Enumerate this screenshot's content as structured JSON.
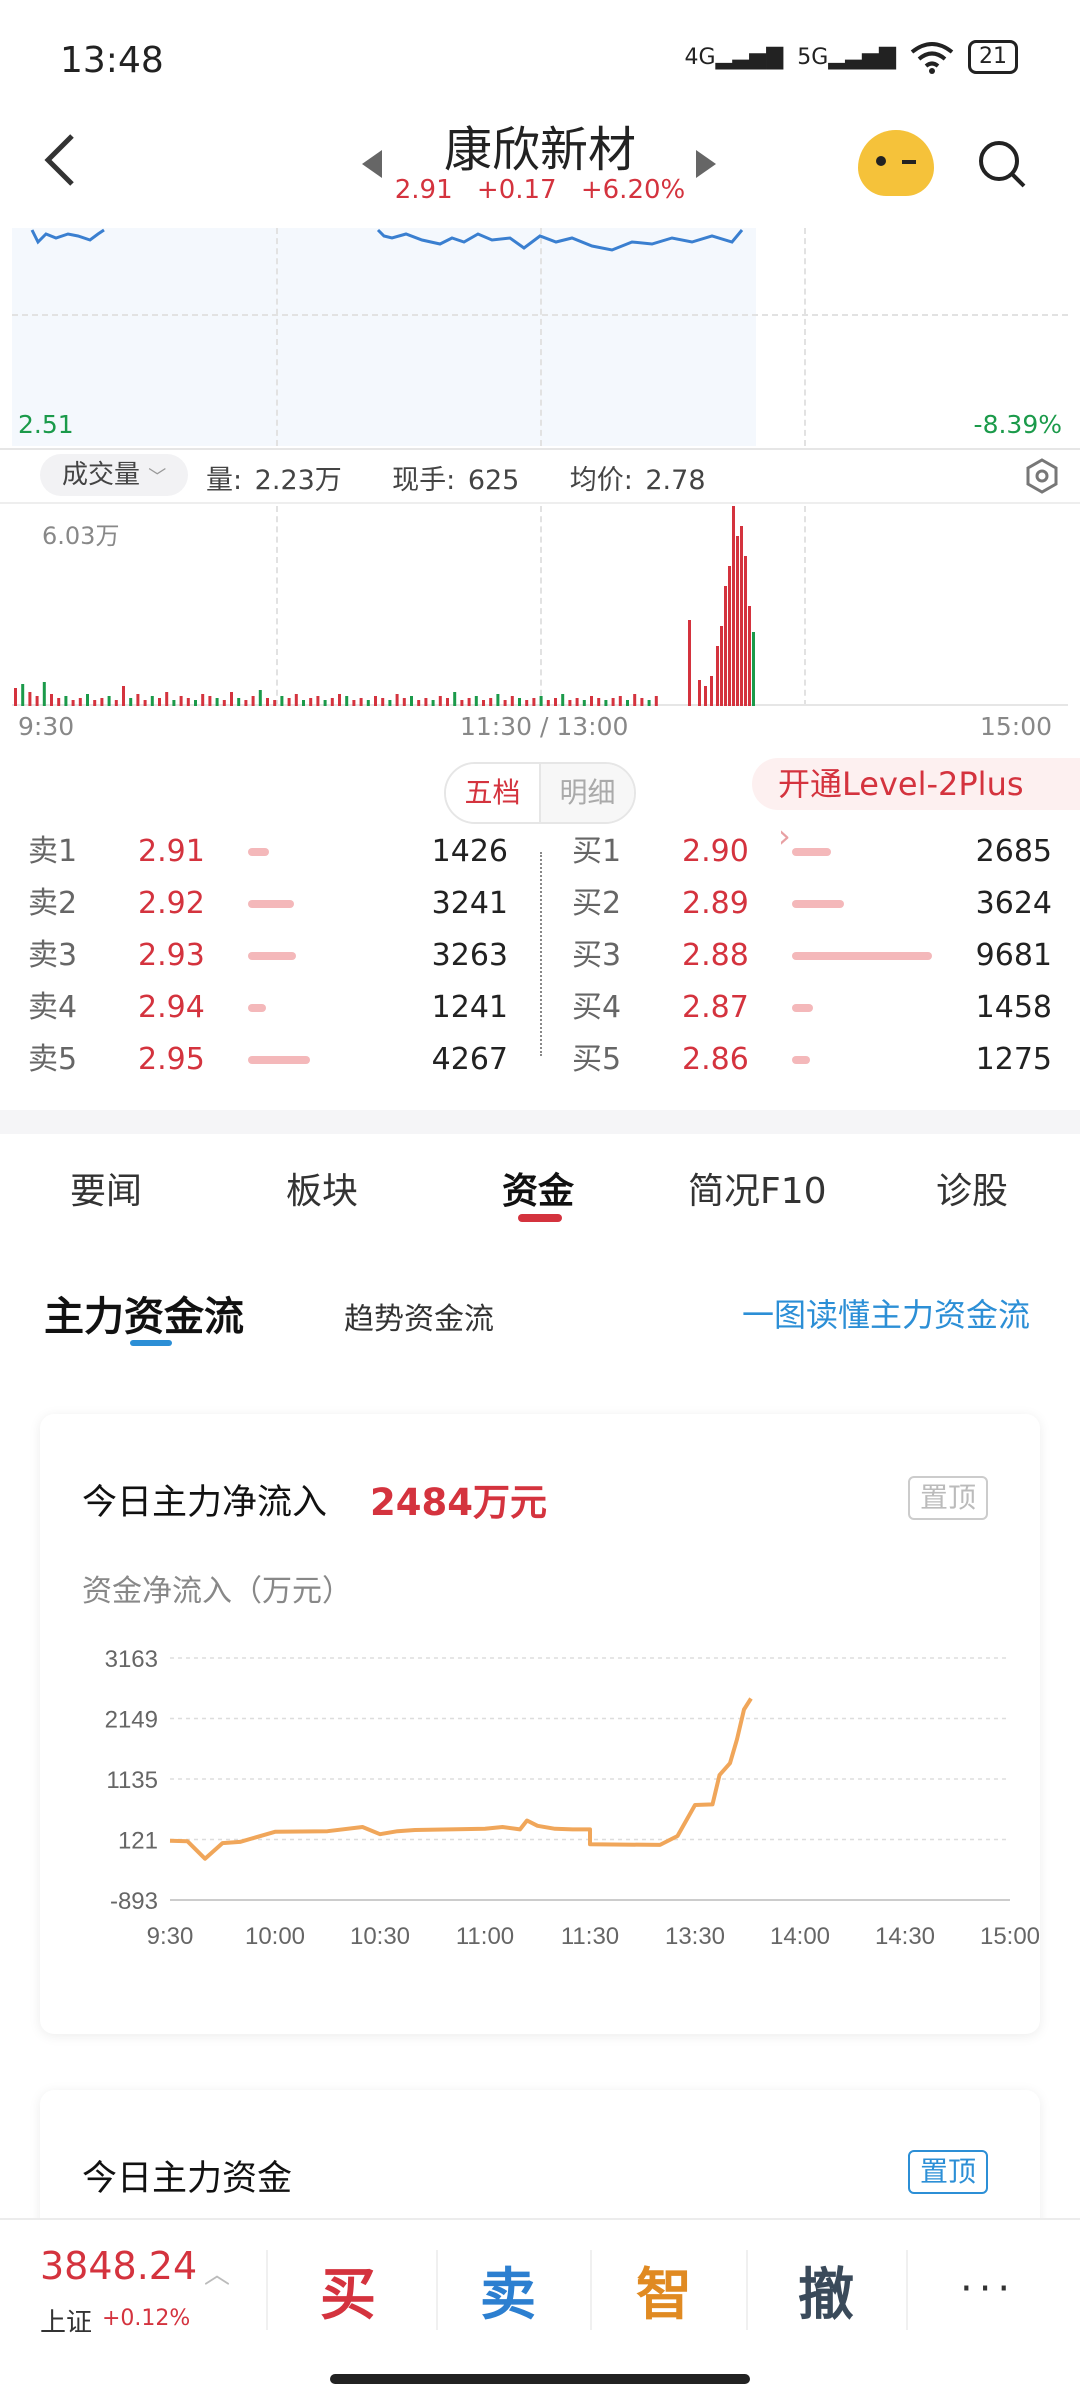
{
  "status_bar": {
    "time": "13:48",
    "net1": "4G",
    "net2": "5G",
    "battery": "21"
  },
  "header": {
    "stock_name": "康欣新材",
    "price": "2.91",
    "change": "+0.17",
    "change_pct": "+6.20%"
  },
  "price_chart": {
    "low_price": "2.51",
    "low_pct": "-8.39%"
  },
  "volume_bar": {
    "selector": "成交量",
    "volume": "量: 2.23万",
    "current_hand": "现手: 625",
    "avg_price": "均价: 2.78",
    "max_label": "6.03万"
  },
  "time_axis": {
    "start": "9:30",
    "mid": "11:30 / 13:00",
    "end": "15:00"
  },
  "order_book": {
    "tabs": [
      "五档",
      "明细"
    ],
    "level2": "开通Level-2Plus",
    "sell": [
      {
        "label": "卖1",
        "price": "2.91",
        "vol": "1426",
        "ratio": 0.15
      },
      {
        "label": "卖2",
        "price": "2.92",
        "vol": "3241",
        "ratio": 0.33
      },
      {
        "label": "卖3",
        "price": "2.93",
        "vol": "3263",
        "ratio": 0.34
      },
      {
        "label": "卖4",
        "price": "2.94",
        "vol": "1241",
        "ratio": 0.13
      },
      {
        "label": "卖5",
        "price": "2.95",
        "vol": "4267",
        "ratio": 0.44
      }
    ],
    "buy": [
      {
        "label": "买1",
        "price": "2.90",
        "vol": "2685",
        "ratio": 0.28
      },
      {
        "label": "买2",
        "price": "2.89",
        "vol": "3624",
        "ratio": 0.37
      },
      {
        "label": "买3",
        "price": "2.88",
        "vol": "9681",
        "ratio": 1.0
      },
      {
        "label": "买4",
        "price": "2.87",
        "vol": "1458",
        "ratio": 0.15
      },
      {
        "label": "买5",
        "price": "2.86",
        "vol": "1275",
        "ratio": 0.13
      }
    ]
  },
  "nav_tabs": [
    "要闻",
    "板块",
    "资金",
    "简况F10",
    "诊股"
  ],
  "funds": {
    "sub_main": "主力资金流",
    "sub_trend": "趋势资金流",
    "link": "一图读懂主力资金流",
    "card1_title": "今日主力净流入",
    "card1_value": "2484万元",
    "pin": "置顶",
    "chart_ylabel": "资金净流入（万元）",
    "card2_title": "今日主力资金"
  },
  "chart_data": {
    "type": "line",
    "ylabel": "资金净流入（万元）",
    "y_ticks": [
      "3163",
      "2149",
      "1135",
      "121",
      "-893"
    ],
    "x_ticks": [
      "9:30",
      "10:00",
      "10:30",
      "11:00",
      "11:30",
      "13:30",
      "14:00",
      "14:30",
      "15:00"
    ],
    "ylim": [
      -893,
      3163
    ],
    "series": [
      {
        "color": "#f0a65a",
        "x": [
          "9:30",
          "9:35",
          "9:40",
          "9:45",
          "9:50",
          "10:00",
          "10:15",
          "10:25",
          "10:30",
          "10:35",
          "10:40",
          "11:00",
          "11:05",
          "11:10",
          "11:12",
          "11:15",
          "11:20",
          "11:25",
          "11:30",
          "13:00",
          "13:20",
          "13:25",
          "13:30",
          "13:35",
          "13:37",
          "13:40",
          "13:42",
          "13:44",
          "13:46"
        ],
        "y": [
          100,
          90,
          -200,
          60,
          80,
          250,
          260,
          330,
          210,
          260,
          280,
          300,
          330,
          290,
          440,
          350,
          300,
          290,
          290,
          40,
          30,
          180,
          700,
          710,
          1200,
          1400,
          1800,
          2300,
          2484
        ]
      }
    ]
  },
  "bottom_bar": {
    "index_value": "3848.24",
    "index_name": "上证",
    "index_change": "+0.12%",
    "actions": [
      "买",
      "卖",
      "智",
      "撤"
    ],
    "more": "···"
  }
}
